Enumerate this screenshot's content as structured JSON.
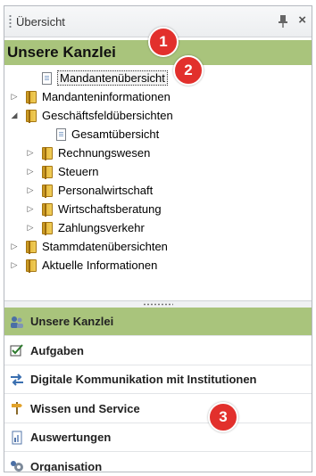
{
  "panel": {
    "title": "Übersicht",
    "pin_icon": "pin-icon",
    "close_glyph": "×"
  },
  "header": {
    "title": "Unsere Kanzlei"
  },
  "badges": [
    "1",
    "2",
    "3"
  ],
  "tree": [
    {
      "label": "Mandantenübersicht",
      "icon": "document",
      "toggle": "",
      "level": 1,
      "selected": true
    },
    {
      "label": "Mandanteninformationen",
      "icon": "folder",
      "toggle": "▷",
      "level": 0
    },
    {
      "label": "Geschäftsfeldübersichten",
      "icon": "folder",
      "toggle": "◢",
      "level": 0
    },
    {
      "label": "Gesamtübersicht",
      "icon": "document",
      "toggle": "",
      "level": 2
    },
    {
      "label": "Rechnungswesen",
      "icon": "folder",
      "toggle": "▷",
      "level": 1
    },
    {
      "label": "Steuern",
      "icon": "folder",
      "toggle": "▷",
      "level": 1
    },
    {
      "label": "Personalwirtschaft",
      "icon": "folder",
      "toggle": "▷",
      "level": 1
    },
    {
      "label": "Wirtschaftsberatung",
      "icon": "folder",
      "toggle": "▷",
      "level": 1
    },
    {
      "label": "Zahlungsverkehr",
      "icon": "folder",
      "toggle": "▷",
      "level": 1
    },
    {
      "label": "Stammdatenübersichten",
      "icon": "folder",
      "toggle": "▷",
      "level": 0
    },
    {
      "label": "Aktuelle Informationen",
      "icon": "folder",
      "toggle": "▷",
      "level": 0
    }
  ],
  "nav": [
    {
      "label": "Unsere Kanzlei",
      "icon": "people-icon",
      "active": true
    },
    {
      "label": "Aufgaben",
      "icon": "checkbox-icon",
      "active": false
    },
    {
      "label": "Digitale Kommunikation mit Institutionen",
      "icon": "exchange-arrows-icon",
      "active": false
    },
    {
      "label": "Wissen und Service",
      "icon": "signpost-icon",
      "active": false
    },
    {
      "label": "Auswertungen",
      "icon": "report-icon",
      "active": false
    },
    {
      "label": "Organisation",
      "icon": "gear-people-icon",
      "active": false
    }
  ],
  "colors": {
    "accent_green": "#a9c47c",
    "badge_red": "#e2302c"
  }
}
